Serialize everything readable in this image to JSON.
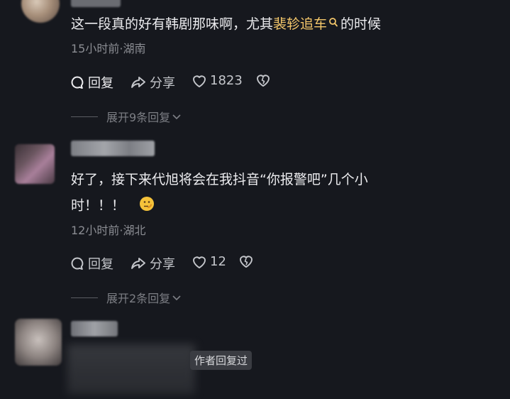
{
  "comments": [
    {
      "text_before": "这一段真的好有韩剧那味啊，尤其",
      "text_highlight": "裴轸追车",
      "text_after": "的时候",
      "meta": "15小时前·湖南",
      "reply_label": "回复",
      "share_label": "分享",
      "like_count": "1823",
      "expand_label": "展开9条回复"
    },
    {
      "line1": "好了，接下来代旭将会在我抖音“你报警吧”几个小",
      "line2": "时！！！",
      "meta": "12小时前·湖北",
      "reply_label": "回复",
      "share_label": "分享",
      "like_count": "12",
      "expand_label": "展开2条回复"
    },
    {
      "author_reply_tag": "作者回复过"
    }
  ],
  "colors": {
    "background": "#16181e",
    "highlight": "#f3c66a",
    "secondary": "#8b8d93"
  },
  "icons": [
    "reply-icon",
    "share-icon",
    "heart-icon",
    "dislike-heart-icon",
    "search-icon",
    "chevron-down-icon",
    "thinking-emoji"
  ]
}
